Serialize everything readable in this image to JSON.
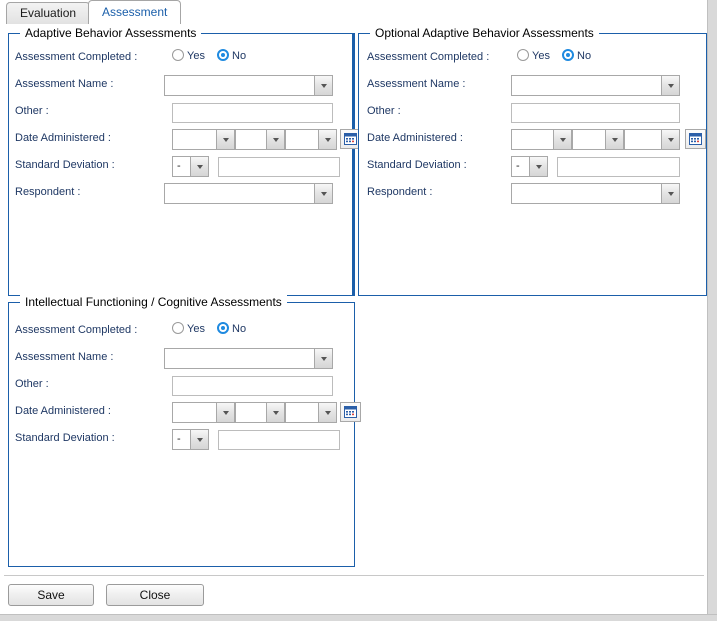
{
  "window": {
    "title": "Assessment"
  },
  "tabs": [
    {
      "id": "evaluation",
      "label": "Evaluation",
      "active": false
    },
    {
      "id": "assessment",
      "label": "Assessment",
      "active": true
    }
  ],
  "colors": {
    "panel_border": "#1b5faa",
    "label_text": "#1f3864",
    "active_tab_text": "#1b5faa",
    "radio_accent": "#1f8ae0",
    "calendar_icon_border": "#2b5fa8",
    "calendar_icon_mark": "#d9443f",
    "frame_gray": "#d9d9d9"
  },
  "panels": {
    "adaptive": {
      "legend": "Adaptive Behavior Assessments",
      "fields": {
        "assessment_completed_label": "Assessment Completed :",
        "assessment_name_label": "Assessment Name :",
        "other_label": "Other :",
        "date_administered_label": "Date Administered :",
        "standard_deviation_label": "Standard Deviation :",
        "respondent_label": "Respondent :"
      },
      "radio": {
        "yes_label": "Yes",
        "no_label": "No",
        "selected": "No"
      },
      "values": {
        "assessment_name": "",
        "other": "",
        "date_month": "",
        "date_day": "",
        "date_year": "",
        "sd_sign": "-",
        "sd_value": "",
        "respondent": ""
      },
      "icons": {
        "calendar": "calendar-icon",
        "dropdown": "chevron-down-icon"
      }
    },
    "optional": {
      "legend": "Optional Adaptive Behavior Assessments",
      "fields": {
        "assessment_completed_label": "Assessment Completed :",
        "assessment_name_label": "Assessment Name :",
        "other_label": "Other :",
        "date_administered_label": "Date Administered :",
        "standard_deviation_label": "Standard Deviation :",
        "respondent_label": "Respondent :"
      },
      "radio": {
        "yes_label": "Yes",
        "no_label": "No",
        "selected": "No"
      },
      "values": {
        "assessment_name": "",
        "other": "",
        "date_month": "",
        "date_day": "",
        "date_year": "",
        "sd_sign": "-",
        "sd_value": "",
        "respondent": ""
      },
      "icons": {
        "calendar": "calendar-icon",
        "dropdown": "chevron-down-icon"
      }
    },
    "intellectual": {
      "legend": "Intellectual Functioning / Cognitive Assessments",
      "fields": {
        "assessment_completed_label": "Assessment Completed :",
        "assessment_name_label": "Assessment Name :",
        "other_label": "Other :",
        "date_administered_label": "Date Administered :",
        "standard_deviation_label": "Standard Deviation :"
      },
      "radio": {
        "yes_label": "Yes",
        "no_label": "No",
        "selected": "No"
      },
      "values": {
        "assessment_name": "",
        "other": "",
        "date_month": "",
        "date_day": "",
        "date_year": "",
        "sd_sign": "-",
        "sd_value": ""
      },
      "icons": {
        "calendar": "calendar-icon",
        "dropdown": "chevron-down-icon"
      }
    }
  },
  "footer": {
    "save_label": "Save",
    "close_label": "Close"
  }
}
